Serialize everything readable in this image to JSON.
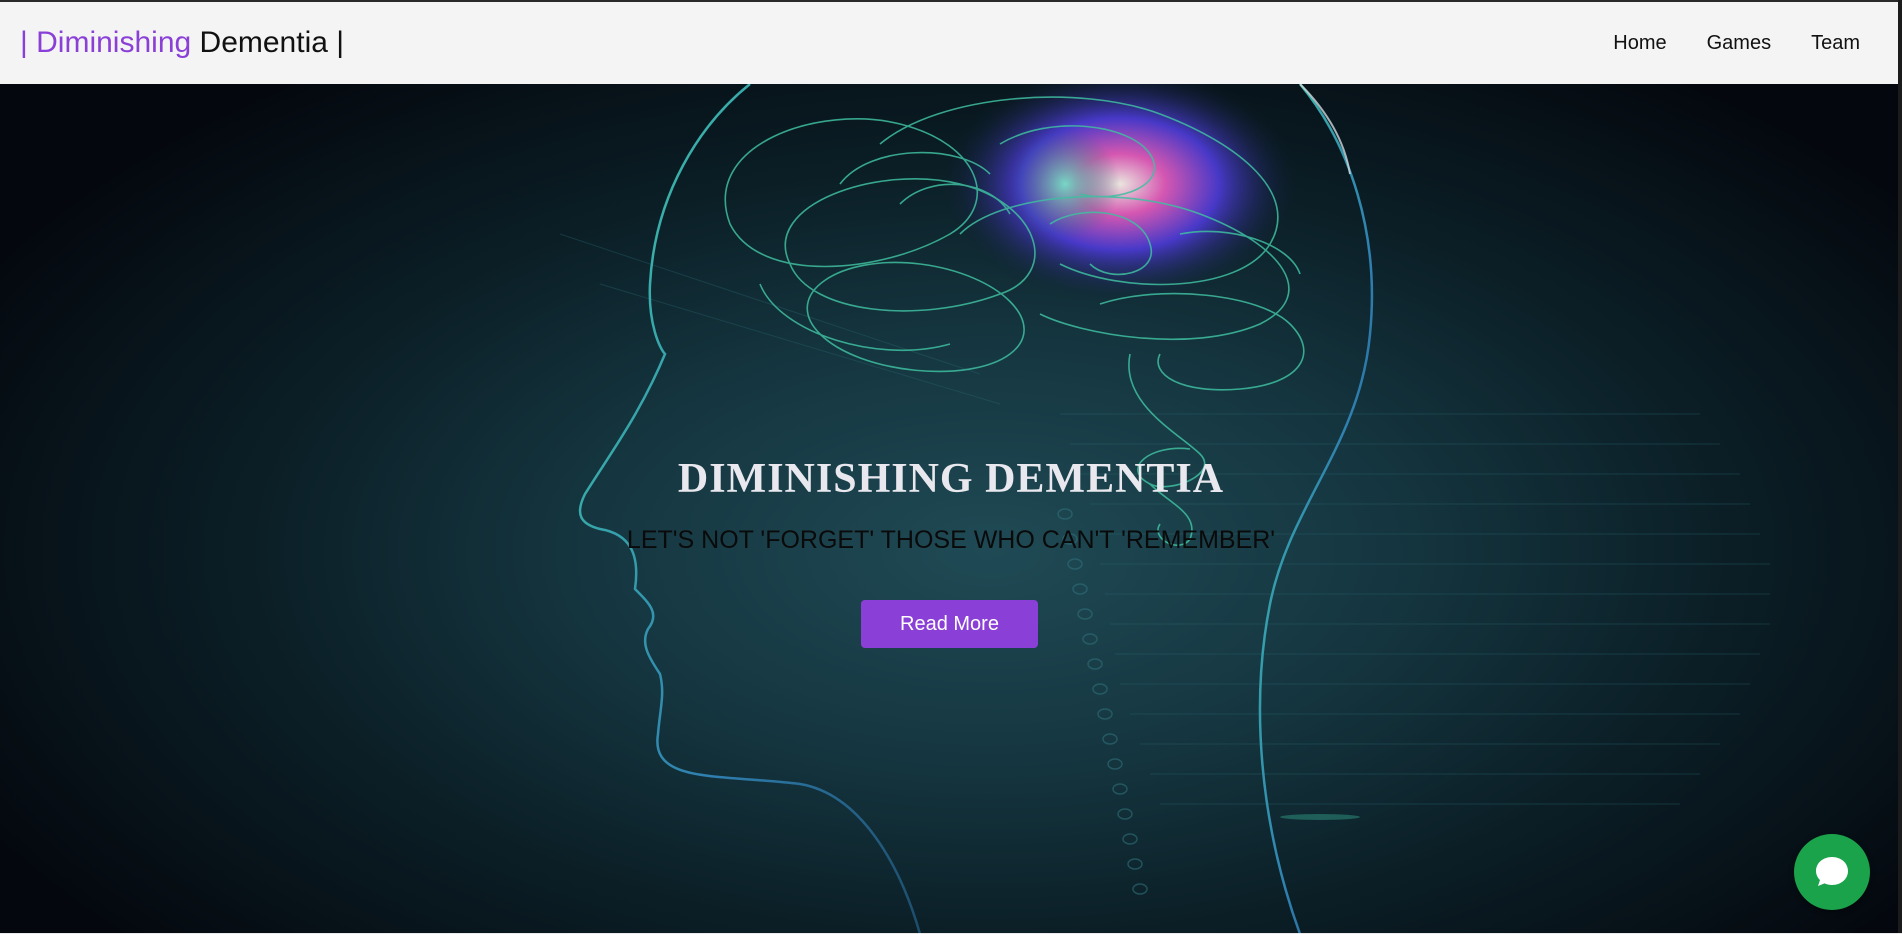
{
  "navbar": {
    "brand_accent": "| Diminishing",
    "brand_rest": " Dementia |",
    "links": [
      "Home",
      "Games",
      "Team"
    ]
  },
  "hero": {
    "title": "DIMINISHING DEMENTIA",
    "subtitle": "LET'S NOT 'FORGET' THOSE WHO CAN'T 'REMEMBER'",
    "button_label": "Read More",
    "image_icon": "head-brain-illustration-icon"
  },
  "chat": {
    "icon": "chat-bubble-icon"
  },
  "colors": {
    "accent": "#8a3fd6",
    "navbar_bg": "#f4f4f4",
    "chat_green": "#1aa34a"
  }
}
